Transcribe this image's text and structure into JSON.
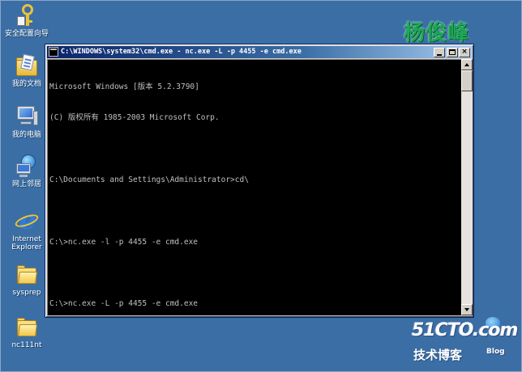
{
  "desktop": {
    "icons": [
      {
        "label": "安全配置向导",
        "icon": "security-wizard-icon"
      },
      {
        "label": "我的文档",
        "icon": "my-documents-icon"
      },
      {
        "label": "我的电脑",
        "icon": "my-computer-icon"
      },
      {
        "label": "网上邻居",
        "icon": "network-places-icon"
      },
      {
        "label": "Internet Explorer",
        "icon": "internet-explorer-icon"
      },
      {
        "label": "sysprep",
        "icon": "folder-icon"
      },
      {
        "label": "nc111nt",
        "icon": "folder-icon"
      }
    ],
    "background_color": "#3a6ea5"
  },
  "watermark": {
    "name": "杨俊峰",
    "site": "51CTO.com",
    "site_subtitle": "技术博客",
    "site_badge": "Blog"
  },
  "window": {
    "title": "C:\\WINDOWS\\system32\\cmd.exe - nc.exe -L -p 4455 -e cmd.exe",
    "buttons": {
      "minimize": "_",
      "maximize": "□",
      "close": "×"
    },
    "console_lines": [
      "Microsoft Windows [版本 5.2.3790]",
      "(C) 版权所有 1985-2003 Microsoft Corp.",
      "",
      "C:\\Documents and Settings\\Administrator>cd\\",
      "",
      "C:\\>nc.exe -l -p 4455 -e cmd.exe",
      "",
      "C:\\>nc.exe -L -p 4455 -e cmd.exe",
      ""
    ]
  }
}
